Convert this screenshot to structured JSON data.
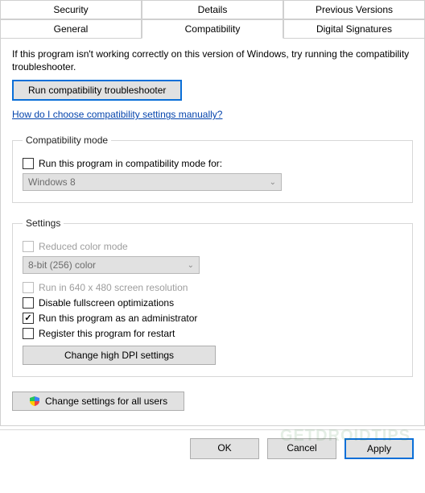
{
  "tabs_row1": [
    "Security",
    "Details",
    "Previous Versions"
  ],
  "tabs_row2": [
    "General",
    "Compatibility",
    "Digital Signatures"
  ],
  "active_tab": "Compatibility",
  "intro": "If this program isn't working correctly on this version of Windows, try running the compatibility troubleshooter.",
  "run_troubleshooter": "Run compatibility troubleshooter",
  "help_link": "How do I choose compatibility settings manually?",
  "compat_mode": {
    "legend": "Compatibility mode",
    "checkbox": "Run this program in compatibility mode for:",
    "select": "Windows 8"
  },
  "settings": {
    "legend": "Settings",
    "reduced_color": "Reduced color mode",
    "color_select": "8-bit (256) color",
    "run_640": "Run in 640 x 480 screen resolution",
    "disable_full": "Disable fullscreen optimizations",
    "run_admin": "Run this program as an administrator",
    "register_restart": "Register this program for restart",
    "change_dpi": "Change high DPI settings"
  },
  "change_all_users": "Change settings for all users",
  "buttons": {
    "ok": "OK",
    "cancel": "Cancel",
    "apply": "Apply"
  },
  "watermark": "GETDROIDTIPS"
}
